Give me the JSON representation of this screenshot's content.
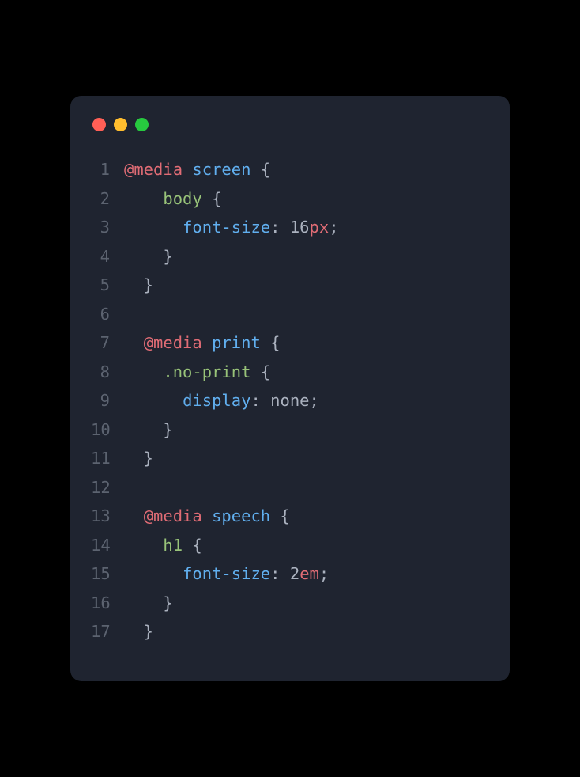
{
  "window_controls": {
    "close": "close",
    "minimize": "minimize",
    "zoom": "zoom"
  },
  "code": {
    "lines": [
      {
        "n": "1",
        "tokens": [
          [
            "key",
            "@media"
          ],
          [
            "punct",
            " "
          ],
          [
            "ident",
            "screen"
          ],
          [
            "punct",
            " {"
          ]
        ]
      },
      {
        "n": "2",
        "tokens": [
          [
            "punct",
            "    "
          ],
          [
            "sel",
            "body"
          ],
          [
            "punct",
            " {"
          ]
        ]
      },
      {
        "n": "3",
        "tokens": [
          [
            "punct",
            "      "
          ],
          [
            "ident",
            "font-size"
          ],
          [
            "punct",
            ": "
          ],
          [
            "num",
            "16"
          ],
          [
            "key",
            "px"
          ],
          [
            "punct",
            ";"
          ]
        ]
      },
      {
        "n": "4",
        "tokens": [
          [
            "punct",
            "    }"
          ]
        ]
      },
      {
        "n": "5",
        "tokens": [
          [
            "punct",
            "  }"
          ]
        ]
      },
      {
        "n": "6",
        "tokens": [
          [
            "punct",
            ""
          ]
        ]
      },
      {
        "n": "7",
        "tokens": [
          [
            "punct",
            "  "
          ],
          [
            "key",
            "@media"
          ],
          [
            "punct",
            " "
          ],
          [
            "ident",
            "print"
          ],
          [
            "punct",
            " {"
          ]
        ]
      },
      {
        "n": "8",
        "tokens": [
          [
            "punct",
            "    "
          ],
          [
            "sel",
            ".no-print"
          ],
          [
            "punct",
            " {"
          ]
        ]
      },
      {
        "n": "9",
        "tokens": [
          [
            "punct",
            "      "
          ],
          [
            "ident",
            "display"
          ],
          [
            "punct",
            ": none;"
          ]
        ]
      },
      {
        "n": "10",
        "tokens": [
          [
            "punct",
            "    }"
          ]
        ]
      },
      {
        "n": "11",
        "tokens": [
          [
            "punct",
            "  }"
          ]
        ]
      },
      {
        "n": "12",
        "tokens": [
          [
            "punct",
            ""
          ]
        ]
      },
      {
        "n": "13",
        "tokens": [
          [
            "punct",
            "  "
          ],
          [
            "key",
            "@media"
          ],
          [
            "punct",
            " "
          ],
          [
            "ident",
            "speech"
          ],
          [
            "punct",
            " {"
          ]
        ]
      },
      {
        "n": "14",
        "tokens": [
          [
            "punct",
            "    "
          ],
          [
            "sel",
            "h1"
          ],
          [
            "punct",
            " {"
          ]
        ]
      },
      {
        "n": "15",
        "tokens": [
          [
            "punct",
            "      "
          ],
          [
            "ident",
            "font-size"
          ],
          [
            "punct",
            ": "
          ],
          [
            "num",
            "2"
          ],
          [
            "key",
            "em"
          ],
          [
            "punct",
            ";"
          ]
        ]
      },
      {
        "n": "16",
        "tokens": [
          [
            "punct",
            "    }"
          ]
        ]
      },
      {
        "n": "17",
        "tokens": [
          [
            "punct",
            "  }"
          ]
        ]
      }
    ]
  }
}
